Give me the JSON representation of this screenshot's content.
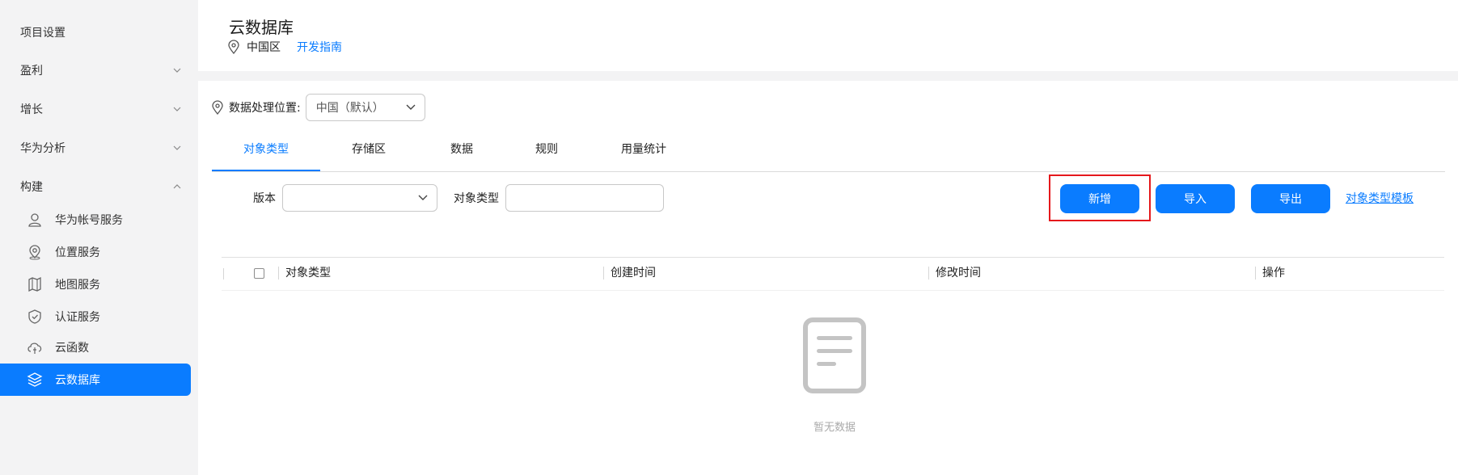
{
  "sidebar": {
    "project_settings": "项目设置",
    "groups": [
      {
        "label": "盈利",
        "expanded": false
      },
      {
        "label": "增长",
        "expanded": false
      },
      {
        "label": "华为分析",
        "expanded": false
      },
      {
        "label": "构建",
        "expanded": true
      }
    ],
    "build_items": [
      {
        "label": "华为帐号服务",
        "icon": "user-icon"
      },
      {
        "label": "位置服务",
        "icon": "location-icon"
      },
      {
        "label": "地图服务",
        "icon": "map-icon"
      },
      {
        "label": "认证服务",
        "icon": "shield-check-icon"
      },
      {
        "label": "云函数",
        "icon": "cloud-function-icon"
      },
      {
        "label": "云数据库",
        "icon": "database-icon",
        "active": true
      }
    ]
  },
  "header": {
    "title": "云数据库",
    "region": "中国区",
    "guide_link": "开发指南"
  },
  "location": {
    "label": "数据处理位置:",
    "selected": "中国（默认）"
  },
  "tabs": [
    {
      "label": "对象类型",
      "active": true
    },
    {
      "label": "存储区"
    },
    {
      "label": "数据"
    },
    {
      "label": "规则"
    },
    {
      "label": "用量统计"
    }
  ],
  "filters": {
    "version_label": "版本",
    "version_value": "",
    "object_type_label": "对象类型",
    "object_type_value": ""
  },
  "actions": {
    "add": "新增",
    "import": "导入",
    "export": "导出",
    "template_link": "对象类型模板"
  },
  "table": {
    "columns": [
      "对象类型",
      "创建时间",
      "修改时间",
      "操作"
    ],
    "rows": [],
    "empty_text": "暂无数据"
  },
  "colors": {
    "primary": "#0a7cff",
    "highlight": "#e5181c",
    "background": "#f3f3f4"
  }
}
